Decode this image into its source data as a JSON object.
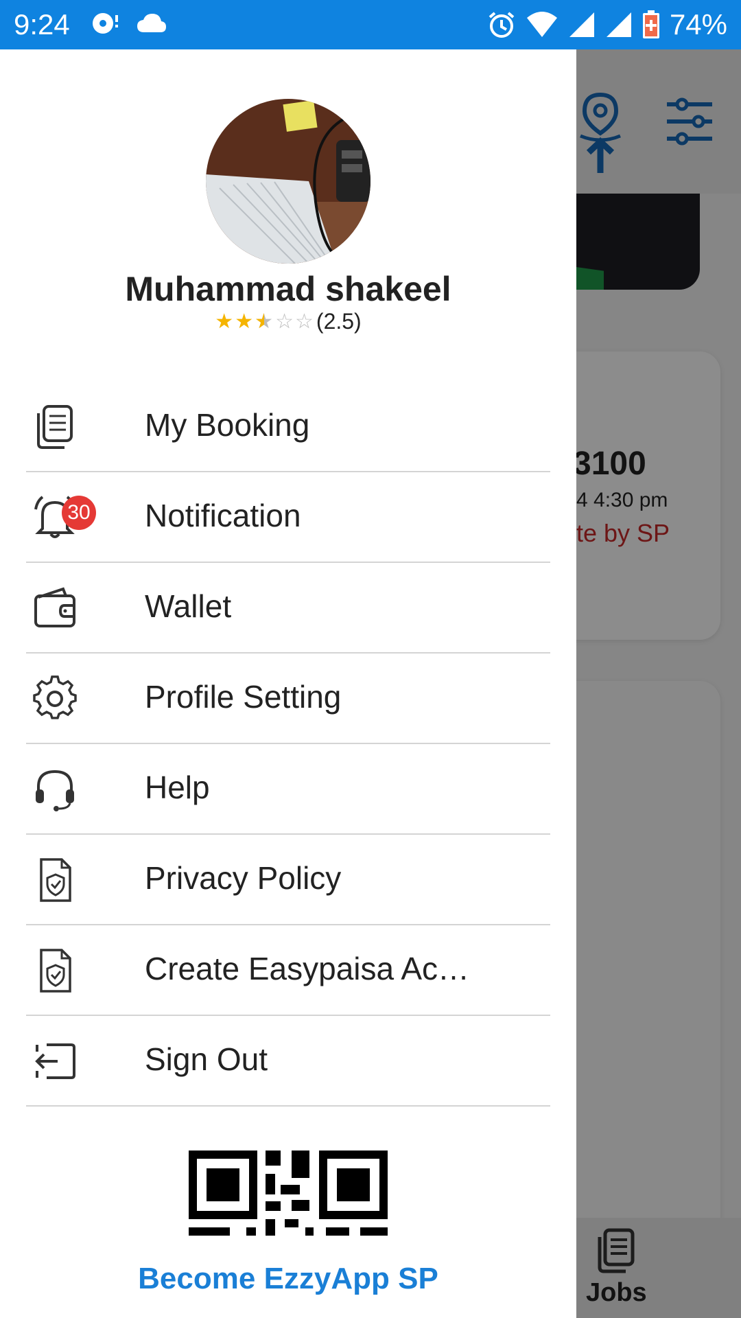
{
  "status_bar": {
    "time": "9:24",
    "battery": "74%",
    "icons": [
      "media-icon",
      "cloud-icon",
      "alarm-icon",
      "wifi-icon",
      "signal-icon",
      "signal-icon",
      "battery-icon"
    ]
  },
  "background": {
    "amount": "3100",
    "date": "4 4:30 pm",
    "status": "te by SP",
    "nav_jobs": "Jobs"
  },
  "drawer": {
    "user_name": "Muhammad shakeel",
    "rating": 2.5,
    "rating_text": "(2.5)",
    "items": [
      {
        "label": "My Booking",
        "icon": "booking-icon"
      },
      {
        "label": "Notification",
        "icon": "bell-icon",
        "badge": "30"
      },
      {
        "label": "Wallet",
        "icon": "wallet-icon"
      },
      {
        "label": "Profile Setting",
        "icon": "gear-icon"
      },
      {
        "label": "Help",
        "icon": "headset-icon"
      },
      {
        "label": "Privacy Policy",
        "icon": "shield-document-icon"
      },
      {
        "label": "Create Easypaisa Ac…",
        "icon": "shield-document-icon"
      },
      {
        "label": "Sign Out",
        "icon": "sign-out-icon"
      }
    ],
    "become_link": "Become EzzyApp SP"
  },
  "colors": {
    "status_bar": "#0f83e0",
    "accent": "#1a7fd6",
    "badge": "#e53935",
    "star": "#f5b400"
  }
}
